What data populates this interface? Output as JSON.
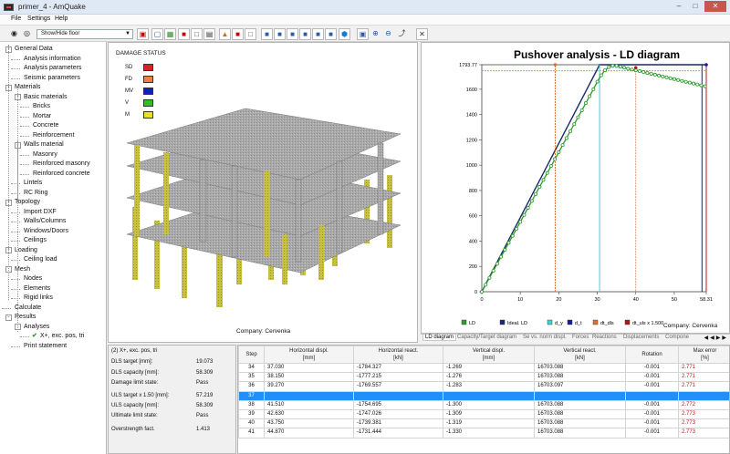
{
  "window": {
    "title": "primer_4 - AmQuake"
  },
  "menu": [
    "File",
    "Settings",
    "Help"
  ],
  "toolbar": {
    "show_hide_label": "Show/Hide floor"
  },
  "tree": [
    {
      "label": "General Data",
      "level": 0,
      "expand": "-"
    },
    {
      "label": "Analysis information",
      "level": 1
    },
    {
      "label": "Analysis parameters",
      "level": 1
    },
    {
      "label": "Seismic parameters",
      "level": 1
    },
    {
      "label": "Materials",
      "level": 0,
      "expand": "-"
    },
    {
      "label": "Basic materials",
      "level": 1,
      "expand": "-"
    },
    {
      "label": "Bricks",
      "level": 2
    },
    {
      "label": "Mortar",
      "level": 2
    },
    {
      "label": "Concrete",
      "level": 2
    },
    {
      "label": "Reinforcement",
      "level": 2
    },
    {
      "label": "Walls material",
      "level": 1,
      "expand": "-"
    },
    {
      "label": "Masonry",
      "level": 2
    },
    {
      "label": "Reinforced masonry",
      "level": 2
    },
    {
      "label": "Reinforced concrete",
      "level": 2
    },
    {
      "label": "Lintels",
      "level": 1
    },
    {
      "label": "RC Ring",
      "level": 1
    },
    {
      "label": "Topology",
      "level": 0,
      "expand": "-"
    },
    {
      "label": "Import DXF",
      "level": 1
    },
    {
      "label": "Walls/Columns",
      "level": 1
    },
    {
      "label": "Windows/Doors",
      "level": 1
    },
    {
      "label": "Ceilings",
      "level": 1
    },
    {
      "label": "Loading",
      "level": 0,
      "expand": "-"
    },
    {
      "label": "Ceiling load",
      "level": 1
    },
    {
      "label": "Mesh",
      "level": 0,
      "expand": "-"
    },
    {
      "label": "Nodes",
      "level": 1
    },
    {
      "label": "Elements",
      "level": 1
    },
    {
      "label": "Rigid links",
      "level": 1
    },
    {
      "label": "Calculate",
      "level": 0
    },
    {
      "label": "Results",
      "level": 0,
      "expand": "-"
    },
    {
      "label": "Analyses",
      "level": 1,
      "expand": "-"
    },
    {
      "label": "X+, exc. pos, tri",
      "level": 2,
      "check": true
    },
    {
      "label": "Print statement",
      "level": 1
    }
  ],
  "damage_status": {
    "title": "DAMAGE STATUS",
    "items": [
      {
        "code": "SD",
        "color": "#e02020"
      },
      {
        "code": "FD",
        "color": "#f08040"
      },
      {
        "code": "MV",
        "color": "#1020c0"
      },
      {
        "code": "V",
        "color": "#30c020"
      },
      {
        "code": "M",
        "color": "#e8e020"
      }
    ]
  },
  "company_label": "Company: Cervenka",
  "chart_data": {
    "type": "line",
    "title": "Pushover analysis - LD diagram",
    "xlim": [
      0,
      58.31
    ],
    "ylim": [
      0,
      1793.77
    ],
    "x_ticks": [
      "0",
      "10",
      "20",
      "30",
      "40",
      "50",
      "58.31"
    ],
    "y_ticks": [
      "0",
      "200",
      "400",
      "600",
      "800",
      "1000",
      "1200",
      "1400",
      "1600",
      "1793.77"
    ],
    "series": [
      {
        "name": "LD",
        "color": "#2a9d2a",
        "x": [
          0,
          1,
          2,
          3,
          4,
          5,
          6,
          7,
          8,
          9,
          10,
          11,
          12,
          13,
          14,
          15,
          16,
          17,
          18,
          19,
          20,
          21,
          22,
          23,
          24,
          25,
          26,
          27,
          28,
          29,
          30,
          31,
          32,
          33,
          34,
          35,
          36,
          37,
          38,
          39,
          40,
          41,
          42,
          43,
          44,
          45,
          46,
          47,
          48,
          49,
          50,
          51,
          52,
          53,
          54,
          55,
          56,
          57,
          58
        ],
        "y": [
          0,
          55,
          110,
          166,
          221,
          276,
          331,
          386,
          441,
          497,
          552,
          607,
          662,
          717,
          772,
          828,
          883,
          938,
          993,
          1048,
          1103,
          1159,
          1214,
          1269,
          1324,
          1379,
          1434,
          1490,
          1545,
          1600,
          1660,
          1710,
          1750,
          1775,
          1785,
          1784,
          1778,
          1770,
          1762,
          1756,
          1750,
          1743,
          1736,
          1729,
          1722,
          1715,
          1708,
          1701,
          1694,
          1687,
          1680,
          1673,
          1666,
          1659,
          1652,
          1645,
          1638,
          1631,
          1624
        ]
      },
      {
        "name": "Ideal. LD",
        "color": "#1a2a6c",
        "x": [
          0,
          30.6,
          58.31
        ],
        "y": [
          0,
          1793.77,
          1793.77
        ]
      },
      {
        "name": "d_y",
        "color": "#40d0d0",
        "x": [
          30.6,
          30.6
        ],
        "y": [
          0,
          1793.77
        ]
      },
      {
        "name": "d_t",
        "color": "#1a1aa0",
        "x": [
          57.2,
          57.2
        ],
        "y": [
          0,
          1793.77
        ]
      },
      {
        "name": "dt_dls",
        "color": "#e07030",
        "x": [
          19.07,
          19.07
        ],
        "y": [
          0,
          1793.77
        ]
      },
      {
        "name": "dt_uls x 1.500",
        "color": "#b01818",
        "x": [
          58.31,
          58.31
        ],
        "y": [
          0,
          1793.77
        ]
      }
    ],
    "markers_orange_dotted": {
      "x": 40.0,
      "y": 1770
    }
  },
  "tabs": [
    "LD diagram",
    "Capacity/Target diagram",
    "Se vs. norm displ.",
    "Forces",
    "Reactions",
    "Displacements",
    "Compone"
  ],
  "info": {
    "header": "(2) X+, exc. pos, tri",
    "rows": [
      {
        "label": "DLS target [mm]:",
        "value": "19.073"
      },
      {
        "label": "DLS capacity [mm]:",
        "value": "58.309"
      },
      {
        "label": "Damage limit state:",
        "value": "Pass"
      },
      {
        "label": "ULS target x 1.50 [mm]:",
        "value": "57.219"
      },
      {
        "label": "ULS capacity [mm]:",
        "value": "58.309"
      },
      {
        "label": "Ultimate limit state:",
        "value": "Pass"
      },
      {
        "label": "Overstrength fact.",
        "value": "1.413"
      }
    ]
  },
  "table": {
    "headers": [
      "Step",
      "Horizontal displ.\n[mm]",
      "Horizontal react.\n[kN]",
      "Vertical displ.\n[mm]",
      "Vertical react.\n[kN]",
      "Rotation",
      "Max error\n[%]"
    ],
    "rows": [
      [
        "34",
        "37.030",
        "-1784.327",
        "-1.269",
        "16703.088",
        "-0.001",
        "2.771"
      ],
      [
        "35",
        "38.150",
        "-1777.215",
        "-1.276",
        "16703.088",
        "-0.001",
        "2.771"
      ],
      [
        "36",
        "39.270",
        "-1769.557",
        "-1.283",
        "16703.097",
        "-0.001",
        "2.771"
      ],
      [
        "37",
        "40.390",
        "-1762.208",
        "-1.291",
        "16703.088",
        "-0.001",
        "2.772"
      ],
      [
        "38",
        "41.510",
        "-1754.695",
        "-1.300",
        "16703.088",
        "-0.001",
        "2.772"
      ],
      [
        "39",
        "42.630",
        "-1747.026",
        "-1.309",
        "16703.088",
        "-0.001",
        "2.773"
      ],
      [
        "40",
        "43.750",
        "-1739.381",
        "-1.319",
        "16703.088",
        "-0.001",
        "2.773"
      ],
      [
        "41",
        "44.870",
        "-1731.444",
        "-1.330",
        "16703.088",
        "-0.001",
        "2.773"
      ]
    ],
    "selected_index": 3
  }
}
